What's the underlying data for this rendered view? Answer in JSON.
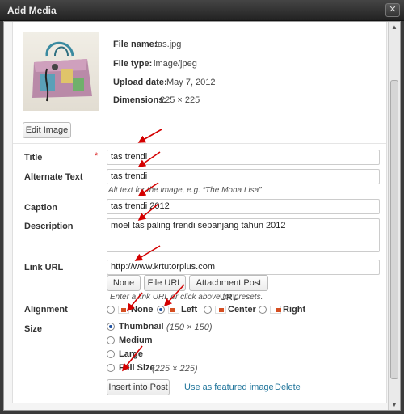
{
  "window": {
    "title": "Add Media"
  },
  "file_info": {
    "name_label": "File name:",
    "name_value": "tas.jpg",
    "type_label": "File type:",
    "type_value": "image/jpeg",
    "date_label": "Upload date:",
    "date_value": "May 7, 2012",
    "dims_label": "Dimensions:",
    "dims_value": "225 × 225"
  },
  "edit_image_label": "Edit Image",
  "form": {
    "title_label": "Title",
    "required_mark": "*",
    "title_value": "tas trendi",
    "alt_label": "Alternate Text",
    "alt_value": "tas trendi",
    "alt_help": "Alt text for the image, e.g. “The Mona Lisa”",
    "caption_label": "Caption",
    "caption_value": "tas trendi 2012",
    "description_label": "Description",
    "description_value": "moel tas paling trendi sepanjang tahun 2012",
    "link_label": "Link URL",
    "link_value": "http://www.krtutorplus.com",
    "link_buttons": [
      "None",
      "File URL",
      "Attachment Post URL"
    ],
    "link_help": "Enter a link URL or click above for presets.",
    "alignment_label": "Alignment",
    "alignment_options": [
      "None",
      "Left",
      "Center",
      "Right"
    ],
    "alignment_selected": "Left",
    "size_label": "Size",
    "size_options": [
      {
        "label": "Thumbnail",
        "dims": "(150 × 150)"
      },
      {
        "label": "Medium",
        "dims": ""
      },
      {
        "label": "Large",
        "dims": ""
      },
      {
        "label": "Full Size",
        "dims": "(225 × 225)"
      }
    ],
    "size_selected": "Thumbnail"
  },
  "actions": {
    "insert_label": "Insert into Post",
    "featured_label": "Use as featured image",
    "delete_label": "Delete"
  },
  "colors": {
    "accent": "#21759b",
    "arrow": "#d40000",
    "required": "#d40000"
  }
}
